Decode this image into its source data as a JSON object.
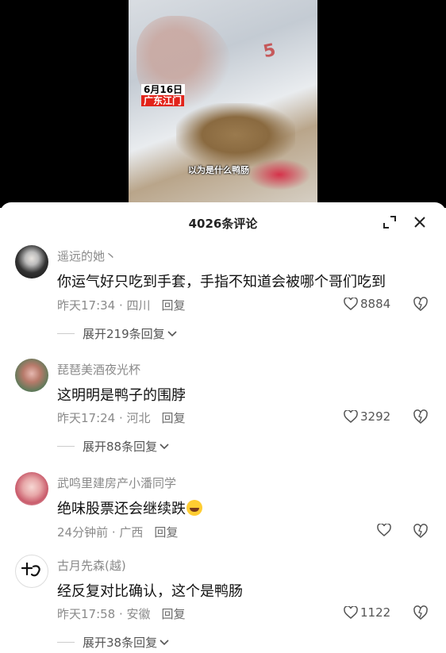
{
  "video": {
    "date": "6月16日",
    "place": "广东江门",
    "caption": "以为是什么鸭肠"
  },
  "sheet": {
    "title": "4026条评论"
  },
  "comments": [
    {
      "user": "遥远的她丶",
      "text": "你运气好只吃到手套，手指不知道会被哪个哥们吃到",
      "time_loc": "昨天17:34 · 四川",
      "reply_label": "回复",
      "likes": "8884",
      "expand": "展开219条回复"
    },
    {
      "user": "琵琶美酒夜光杯",
      "text": "这明明是鸭子的围脖",
      "time_loc": "昨天17:24 · 河北",
      "reply_label": "回复",
      "likes": "3292",
      "expand": "展开88条回复"
    },
    {
      "user": "武鸣里建房产小潘同学",
      "text": "绝味股票还会继续跌",
      "time_loc": "24分钟前 · 广西",
      "reply_label": "回复",
      "likes": ""
    },
    {
      "user": "古月先森(越)",
      "text": "经反复对比确认，这个是鸭肠",
      "time_loc": "昨天17:58 · 安徽",
      "reply_label": "回复",
      "likes": "1122",
      "expand": "展开38条回复"
    }
  ]
}
